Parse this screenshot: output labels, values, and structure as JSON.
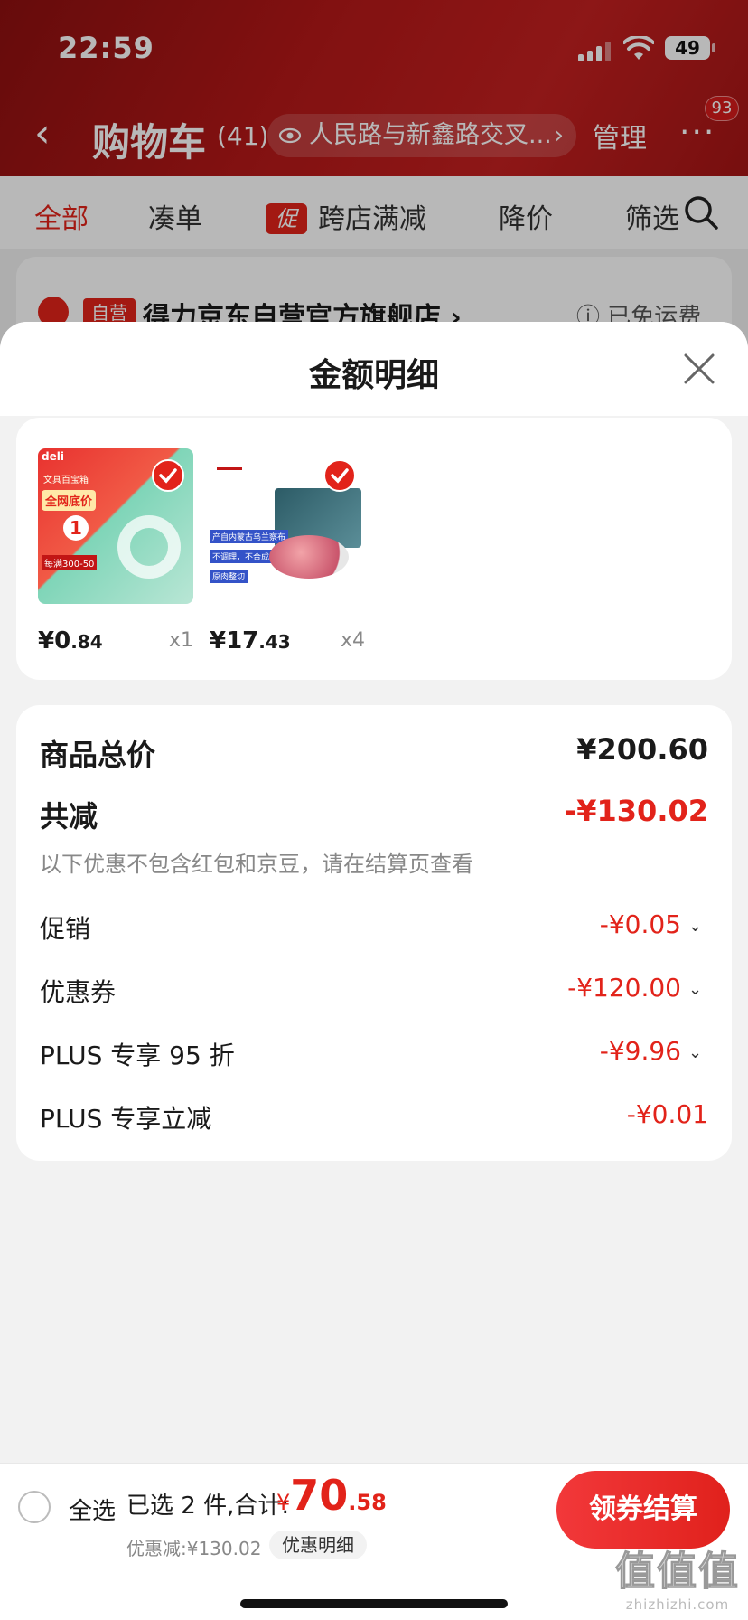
{
  "status_bar": {
    "time": "22:59",
    "battery": "49"
  },
  "nav": {
    "title": "购物车",
    "count": "(41)",
    "location": "人民路与新鑫路交叉...",
    "manage": "管理",
    "more_badge": "93"
  },
  "tabs": [
    {
      "label": "全部",
      "active": true
    },
    {
      "label": "凑单"
    },
    {
      "label": "跨店满减",
      "tag": "促"
    },
    {
      "label": "降价"
    },
    {
      "label": "筛选"
    }
  ],
  "store": {
    "self_tag": "自营",
    "name": "得力京东自营官方旗舰店 ›",
    "shipping": "已免运费"
  },
  "sheet": {
    "title": "金额明细",
    "products": [
      {
        "price_int": "¥0",
        "price_dec": ".84",
        "qty": "x1",
        "image": "tape-roll-product",
        "img_text_brand": "deli",
        "img_text_1": "文具百宝箱",
        "img_text_2": "全网底价",
        "img_text_3": "1",
        "img_text_4": "每满300-50"
      },
      {
        "price_int": "¥17",
        "price_dec": ".43",
        "qty": "x4",
        "image": "lamb-roll-product",
        "img_text_1": "产自内蒙古乌兰察布",
        "img_text_2": "不调理，不合成",
        "img_text_3": "原肉整切"
      }
    ],
    "summary": {
      "total_label": "商品总价",
      "total_value": "¥200.60",
      "reduce_label": "共减",
      "reduce_value": "-¥130.02",
      "note": "以下优惠不包含红包和京豆，请在结算页查看",
      "items": [
        {
          "label": "促销",
          "value": "-¥0.05",
          "expandable": true
        },
        {
          "label": "优惠券",
          "value": "-¥120.00",
          "expandable": true
        },
        {
          "label": "PLUS 专享 95 折",
          "value": "-¥9.96",
          "expandable": true
        },
        {
          "label": "PLUS 专享立减",
          "value": "-¥0.01",
          "expandable": false
        }
      ]
    }
  },
  "bottom": {
    "select_all": "全选",
    "selected_text": "已选 2 件,合计:",
    "total_yen": "¥",
    "total_int": "70",
    "total_dec": ".58",
    "discount_text": "优惠减:¥130.02",
    "detail_label": "优惠明细",
    "checkout_label": "领券结算"
  },
  "watermark": {
    "big": "值值值",
    "small": "zhizhizhi.com"
  },
  "colors": {
    "accent": "#e2231a",
    "header": "#b51818"
  }
}
